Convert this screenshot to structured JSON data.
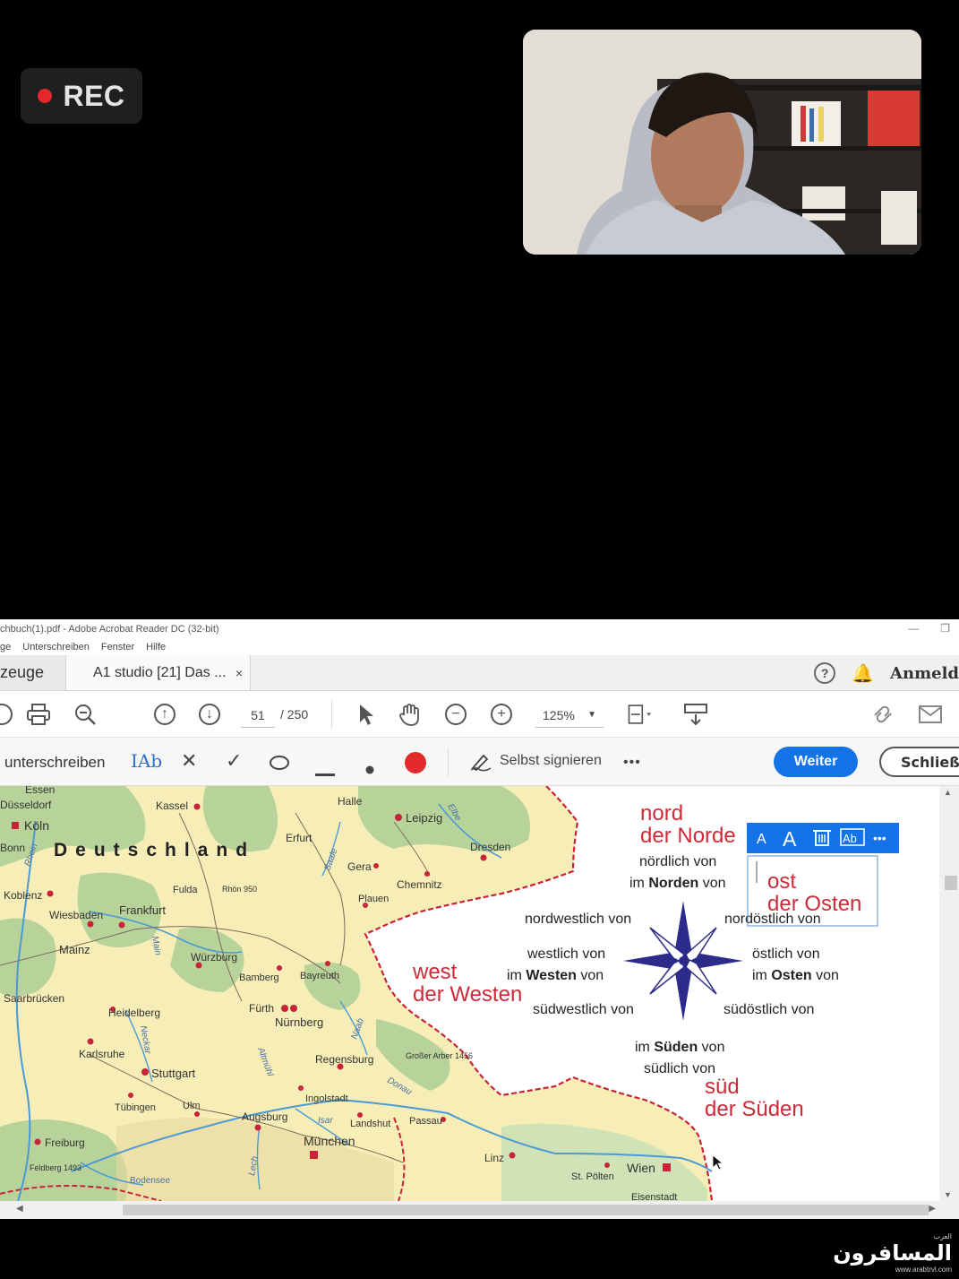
{
  "recording": {
    "label": "REC"
  },
  "acrobat": {
    "title": "chbuch(1).pdf - Adobe Acrobat Reader DC (32-bit)",
    "menu": [
      "ge",
      "Unterschreiben",
      "Fenster",
      "Hilfe"
    ],
    "tabs": {
      "tools": "zeuge",
      "document": "A1 studio [21] Das ...",
      "close": "×"
    },
    "help_icon": "?",
    "account": "Anmeld",
    "page": {
      "current": "51",
      "total": "/  250"
    },
    "zoom": "125%",
    "signbar": {
      "label": "unterschreiben",
      "text_tool": "IAb",
      "selbst": "Selbst signieren",
      "more": "•••",
      "next_button": "Weiter",
      "close_button": "Schließe"
    }
  },
  "map": {
    "cities": [
      "Essen",
      "Düsseldorf",
      "Köln",
      "Bonn",
      "Koblenz",
      "Wiesbaden",
      "Frankfurt",
      "Mainz",
      "Kassel",
      "Halle",
      "Leipzig",
      "Dresden",
      "Erfurt",
      "Gera",
      "Chemnitz",
      "Fulda",
      "Rhön 950",
      "Plauen",
      "Würzburg",
      "Bamberg",
      "Bayreuth",
      "Fürth",
      "Nürnberg",
      "Saarbrücken",
      "Heidelberg",
      "Karlsruhe",
      "Stuttgart",
      "Tübingen",
      "Ulm",
      "Regensburg",
      "Großer Arber 1456",
      "Ingolstadt",
      "Augsburg",
      "Landshut",
      "Passau",
      "München",
      "Freiburg",
      "Feldberg 1493",
      "Bodensee",
      "Linz",
      "St. Pölten",
      "Wien",
      "Eisenstadt"
    ],
    "rivers": [
      "Rhein",
      "Main",
      "Elbe",
      "Saale",
      "Neckar",
      "Donau",
      "Isar",
      "Lech",
      "Naab",
      "Altmühl"
    ],
    "country": "Deutschland"
  },
  "compass": {
    "north_word": "nord",
    "north_noun": "der Norde",
    "north_adj": "nördlich von",
    "north_phrase_pre": "im ",
    "north_phrase_bold": "Norden",
    "north_phrase_post": " von",
    "nw": "nordwestlich von",
    "ne": "nordöstlich von",
    "west_word": "west",
    "west_noun": "der Westen",
    "west_adj": "westlich von",
    "west_phrase_pre": "im ",
    "west_phrase_bold": "Westen",
    "west_phrase_post": " von",
    "east_word": "ost",
    "east_noun": "der Osten",
    "east_adj": "östlich von",
    "east_phrase_pre": "im ",
    "east_phrase_bold": "Osten",
    "east_phrase_post": " von",
    "sw": "südwestlich von",
    "se": "südöstlich von",
    "south_phrase_pre": "im ",
    "south_phrase_bold": "Süden",
    "south_phrase_post": " von",
    "south_adj": "südlich von",
    "south_word": "süd",
    "south_noun": "der Süden",
    "textbox_toolbar": [
      "A",
      "A",
      "🗑",
      "Ab",
      "•••"
    ]
  },
  "watermark": {
    "arabic": "المسافرون",
    "arabic_small": "العرب",
    "url": "www.arabtrvl.com"
  },
  "colors": {
    "accent_red": "#cf2a38",
    "acrobat_blue": "#1473e6",
    "compass_blue": "#2d2b8a",
    "rec_red": "#e5282b"
  }
}
